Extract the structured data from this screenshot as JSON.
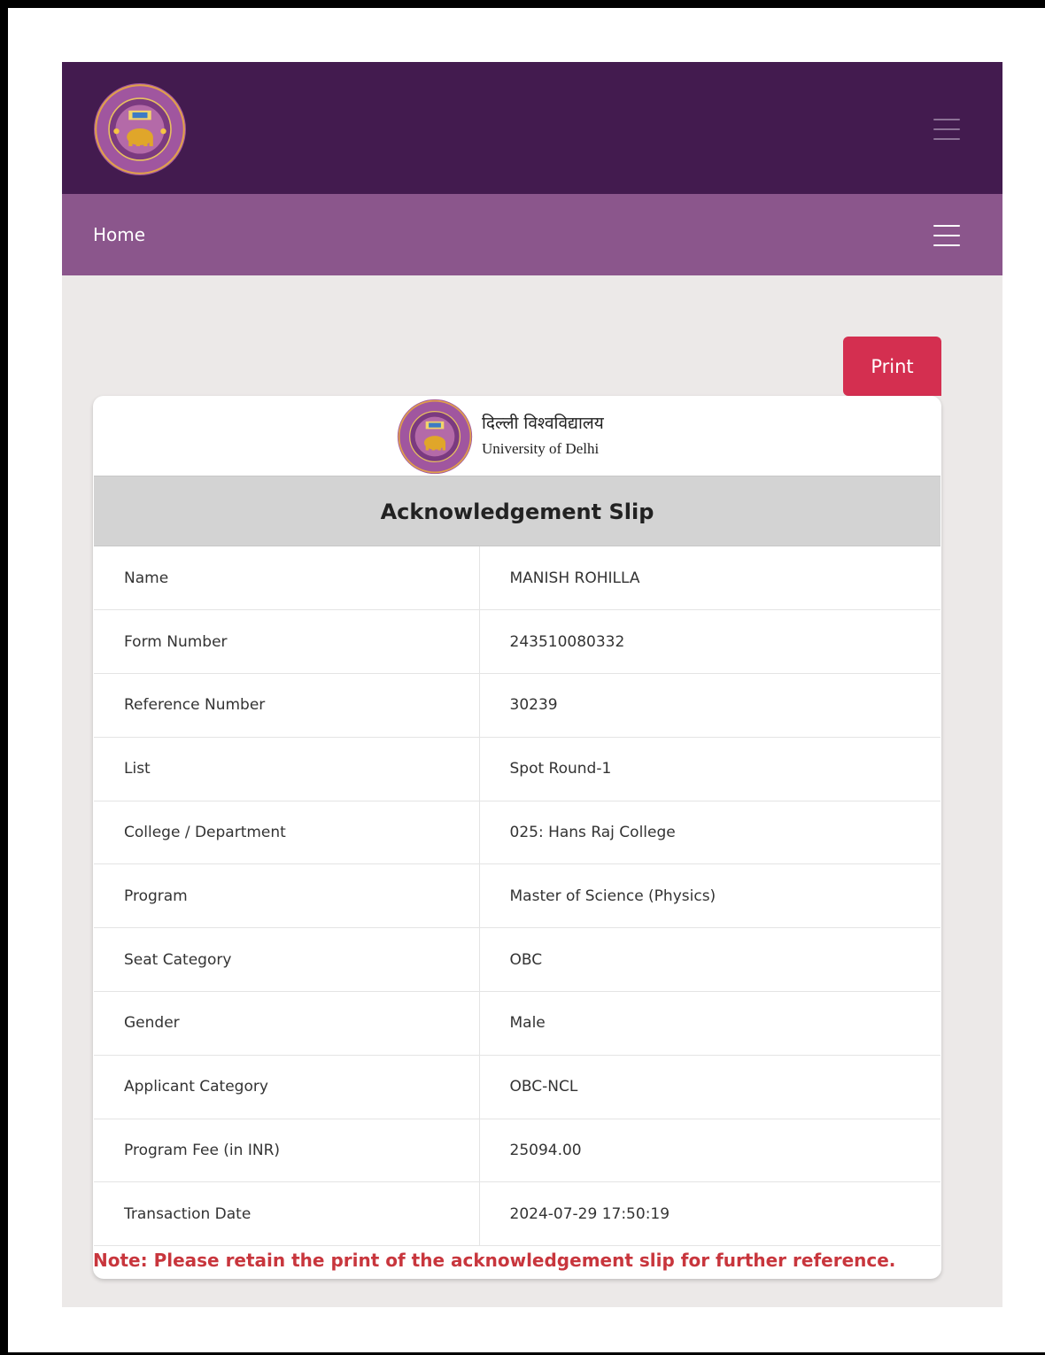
{
  "header": {
    "logo_icon": "university-of-delhi-seal-icon",
    "menu_icon": "hamburger-icon"
  },
  "navbar": {
    "home_label": "Home",
    "menu_icon": "hamburger-icon"
  },
  "print_button": {
    "label": "Print"
  },
  "slip": {
    "hindi_name": "दिल्ली विश्वविद्यालय",
    "english_name": "University of Delhi",
    "title": "Acknowledgement Slip",
    "rows": [
      {
        "label": "Name",
        "value": "MANISH ROHILLA"
      },
      {
        "label": "Form Number",
        "value": "243510080332"
      },
      {
        "label": "Reference Number",
        "value": "30239"
      },
      {
        "label": "List",
        "value": "Spot Round-1"
      },
      {
        "label": "College / Department",
        "value": "025: Hans Raj College"
      },
      {
        "label": "Program",
        "value": "Master of Science (Physics)"
      },
      {
        "label": "Seat Category",
        "value": "OBC"
      },
      {
        "label": "Gender",
        "value": "Male"
      },
      {
        "label": "Applicant Category",
        "value": "OBC-NCL"
      },
      {
        "label": "Program Fee (in INR)",
        "value": "25094.00"
      },
      {
        "label": "Transaction Date",
        "value": "2024-07-29 17:50:19"
      }
    ],
    "note": "Note: Please retain the print of the acknowledgement slip for further reference."
  },
  "colors": {
    "topbar": "#431b4f",
    "navbar": "#8b568c",
    "print_button": "#d42f50",
    "note_text": "#c8363d",
    "page_bg": "#ece9e8"
  }
}
